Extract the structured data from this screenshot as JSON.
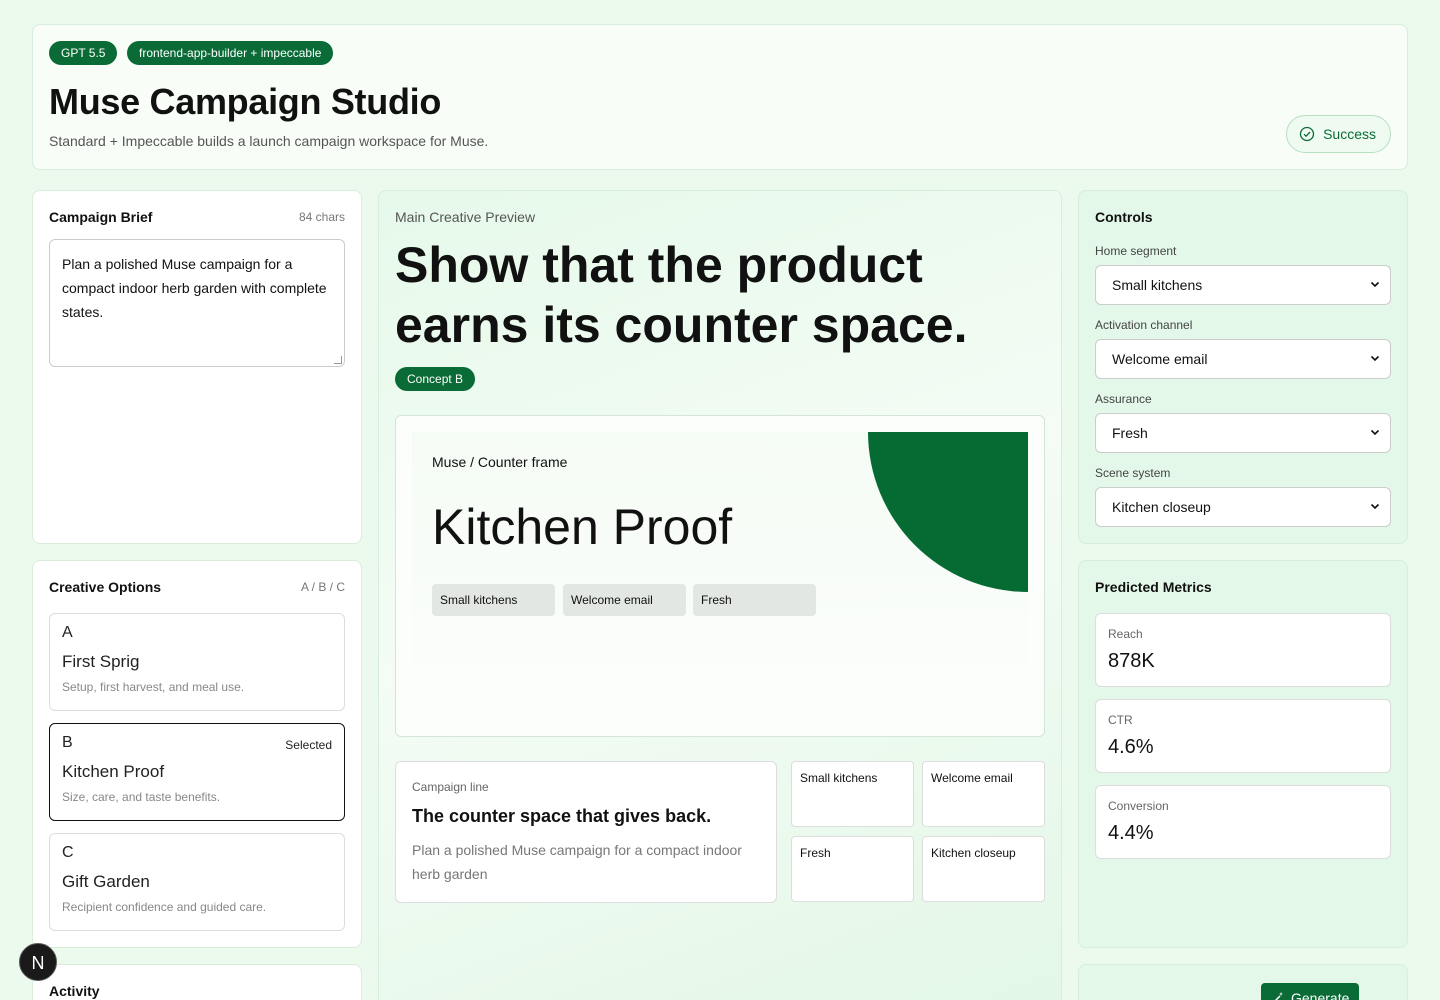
{
  "header": {
    "badges": [
      "GPT 5.5",
      "frontend-app-builder + impeccable"
    ],
    "title": "Muse Campaign Studio",
    "subtitle": "Standard + Impeccable builds a launch campaign workspace for Muse.",
    "status": "Success"
  },
  "brief": {
    "title": "Campaign Brief",
    "meta": "84 chars",
    "text": "Plan a polished Muse campaign for a compact indoor herb garden with complete states."
  },
  "options": {
    "title": "Creative Options",
    "meta": "A / B / C",
    "items": [
      {
        "letter": "A",
        "name": "First Sprig",
        "desc": "Setup, first harvest, and meal use.",
        "selected": ""
      },
      {
        "letter": "B",
        "name": "Kitchen Proof",
        "desc": "Size, care, and taste benefits.",
        "selected": "Selected"
      },
      {
        "letter": "C",
        "name": "Gift Garden",
        "desc": "Recipient confidence and guided care.",
        "selected": ""
      }
    ]
  },
  "activity": {
    "title": "Activity"
  },
  "preview": {
    "label": "Main Creative Preview",
    "headline": "Show that the product earns its counter space.",
    "concept": "Concept B",
    "frame": {
      "crumb": "Muse / Counter frame",
      "hero": "Kitchen Proof",
      "chips": [
        "Small kitchens",
        "Welcome email",
        "Fresh"
      ]
    },
    "campaign_line": {
      "label": "Campaign line",
      "title": "The counter space that gives back.",
      "body": "Plan a polished Muse campaign for a compact indoor herb garden"
    },
    "tiles": [
      "Small kitchens",
      "Welcome email",
      "Fresh",
      "Kitchen closeup"
    ]
  },
  "controls": {
    "title": "Controls",
    "fields": [
      {
        "label": "Home segment",
        "value": "Small kitchens"
      },
      {
        "label": "Activation channel",
        "value": "Welcome email"
      },
      {
        "label": "Assurance",
        "value": "Fresh"
      },
      {
        "label": "Scene system",
        "value": "Kitchen closeup"
      }
    ]
  },
  "metrics": {
    "title": "Predicted Metrics",
    "items": [
      {
        "label": "Reach",
        "value": "878K"
      },
      {
        "label": "CTR",
        "value": "4.6%"
      },
      {
        "label": "Conversion",
        "value": "4.4%"
      }
    ]
  },
  "generate": {
    "label": "Generate"
  },
  "floating_badge": "N",
  "colors": {
    "accent": "#0a6b36",
    "background": "#ecfaee",
    "blob": "#066b33"
  },
  "icons": {
    "status": "check-circle-icon",
    "generate": "wand-icon",
    "select": "chevron-down-icon"
  }
}
